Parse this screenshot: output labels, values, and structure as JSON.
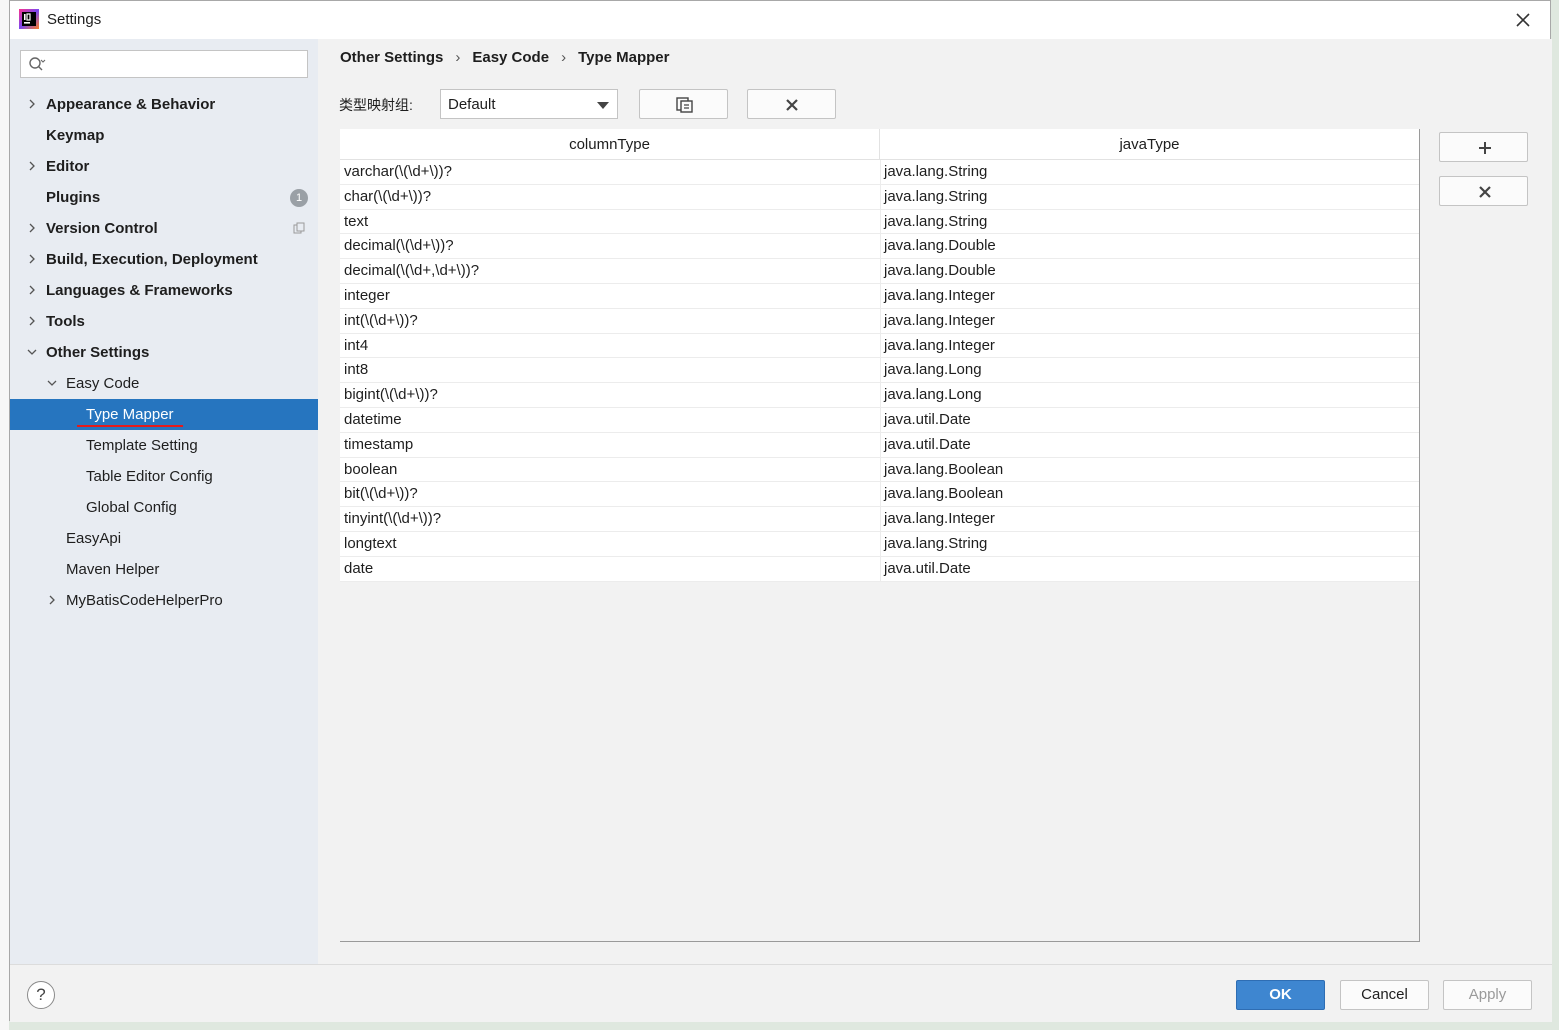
{
  "window": {
    "title": "Settings"
  },
  "search": {
    "placeholder": ""
  },
  "tree": [
    {
      "label": "Appearance & Behavior"
    },
    {
      "label": "Keymap"
    },
    {
      "label": "Editor"
    },
    {
      "label": "Plugins",
      "badge": "1"
    },
    {
      "label": "Version Control"
    },
    {
      "label": "Build, Execution, Deployment"
    },
    {
      "label": "Languages & Frameworks"
    },
    {
      "label": "Tools"
    },
    {
      "label": "Other Settings"
    },
    {
      "label": "Easy Code"
    },
    {
      "label": "Type Mapper"
    },
    {
      "label": "Template Setting"
    },
    {
      "label": "Table Editor Config"
    },
    {
      "label": "Global Config"
    },
    {
      "label": "EasyApi"
    },
    {
      "label": "Maven Helper"
    },
    {
      "label": "MyBatisCodeHelperPro"
    }
  ],
  "breadcrumb": [
    "Other Settings",
    "Easy Code",
    "Type Mapper"
  ],
  "toolbar": {
    "group_label": "类型映射组:",
    "group_value": "Default"
  },
  "table": {
    "columns": [
      "columnType",
      "javaType"
    ],
    "rows": [
      [
        "varchar(\\(\\d+\\))?",
        "java.lang.String"
      ],
      [
        "char(\\(\\d+\\))?",
        "java.lang.String"
      ],
      [
        "text",
        "java.lang.String"
      ],
      [
        "decimal(\\(\\d+\\))?",
        "java.lang.Double"
      ],
      [
        "decimal(\\(\\d+,\\d+\\))?",
        "java.lang.Double"
      ],
      [
        "integer",
        "java.lang.Integer"
      ],
      [
        "int(\\(\\d+\\))?",
        "java.lang.Integer"
      ],
      [
        "int4",
        "java.lang.Integer"
      ],
      [
        "int8",
        "java.lang.Long"
      ],
      [
        "bigint(\\(\\d+\\))?",
        "java.lang.Long"
      ],
      [
        "datetime",
        "java.util.Date"
      ],
      [
        "timestamp",
        "java.util.Date"
      ],
      [
        "boolean",
        "java.lang.Boolean"
      ],
      [
        "bit(\\(\\d+\\))?",
        "java.lang.Boolean"
      ],
      [
        "tinyint(\\(\\d+\\))?",
        "java.lang.Integer"
      ],
      [
        "longtext",
        "java.lang.String"
      ],
      [
        "date",
        "java.util.Date"
      ]
    ]
  },
  "buttons": {
    "ok": "OK",
    "cancel": "Cancel",
    "apply": "Apply",
    "help": "?"
  },
  "colors": {
    "selection": "#2675bf",
    "ok_button": "#3e86d0",
    "annotation": "#e51a1a"
  }
}
